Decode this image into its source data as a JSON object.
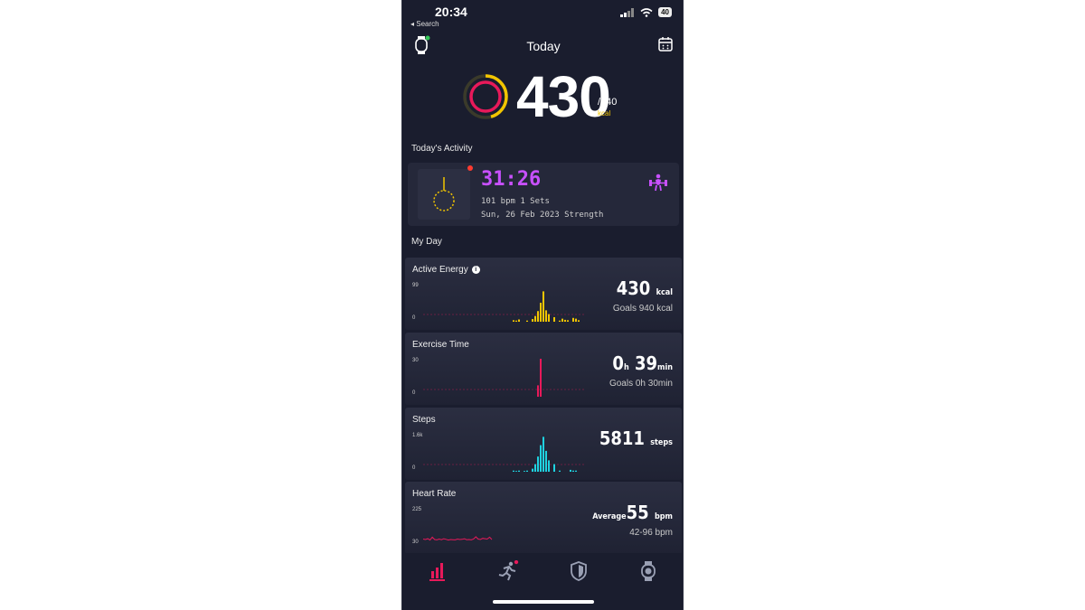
{
  "status": {
    "time": "20:34",
    "back": "◂ Search",
    "battery": "40"
  },
  "header": {
    "title": "Today"
  },
  "summary": {
    "value": "430",
    "goal": "/940",
    "unit": "kcal",
    "progress": 0.457
  },
  "sections": {
    "activity": "Today's Activity",
    "myday": "My Day"
  },
  "activity": {
    "duration": "31:26",
    "meta": "101 bpm   1 Sets",
    "date": "Sun, 26 Feb 2023 Strength"
  },
  "cards": {
    "energy": {
      "title": "Active Energy",
      "ymax": "99",
      "ymin": "0",
      "value": "430",
      "unit": "kcal",
      "goal": "Goals 940 kcal",
      "bars": [
        0,
        0,
        0,
        0,
        0,
        0,
        0,
        0,
        0,
        0,
        0,
        0,
        0,
        0,
        0,
        0,
        0,
        0,
        0,
        0,
        0,
        0,
        0,
        0,
        0,
        0,
        0,
        0,
        0,
        0,
        0,
        0,
        0,
        4,
        3,
        6,
        0,
        0,
        3,
        0,
        7,
        15,
        28,
        50,
        80,
        30,
        20,
        0,
        12,
        0,
        3,
        8,
        5,
        4,
        0,
        10,
        8,
        4,
        0,
        0
      ]
    },
    "exercise": {
      "title": "Exercise Time",
      "ymax": "30",
      "ymin": "0",
      "value_h": "0",
      "value_m": "39",
      "goal": "Goals 0h 30min",
      "bars": [
        0,
        0,
        0,
        0,
        0,
        0,
        0,
        0,
        0,
        0,
        0,
        0,
        0,
        0,
        0,
        0,
        0,
        0,
        0,
        0,
        0,
        0,
        0,
        0,
        0,
        0,
        0,
        0,
        0,
        0,
        0,
        0,
        0,
        0,
        0,
        0,
        0,
        0,
        0,
        0,
        0,
        0,
        30,
        100,
        0,
        0,
        0,
        0,
        0,
        0,
        0,
        0,
        0,
        0,
        0,
        0,
        0,
        0,
        0,
        0
      ]
    },
    "steps": {
      "title": "Steps",
      "ymax": "1.6k",
      "ymin": "0",
      "value": "5811",
      "unit": "steps",
      "bars": [
        0,
        0,
        0,
        0,
        0,
        0,
        0,
        0,
        0,
        0,
        0,
        0,
        0,
        0,
        0,
        0,
        0,
        0,
        0,
        0,
        0,
        0,
        0,
        0,
        0,
        0,
        0,
        0,
        0,
        0,
        0,
        0,
        0,
        3,
        2,
        3,
        0,
        2,
        3,
        0,
        8,
        20,
        40,
        70,
        92,
        55,
        30,
        0,
        20,
        0,
        3,
        0,
        0,
        0,
        5,
        3,
        3,
        0,
        0,
        0
      ]
    },
    "heart": {
      "title": "Heart Rate",
      "ymax": "225",
      "ymin": "30",
      "avg_label": "Average",
      "avg_value": "55",
      "unit": "bpm",
      "range": "42-96 bpm",
      "series": [
        60,
        58,
        62,
        55,
        70,
        58,
        56,
        60,
        57,
        62,
        59,
        55,
        58,
        57,
        56,
        60,
        58,
        59,
        62,
        57,
        58,
        56,
        60,
        72,
        60,
        58,
        64,
        62,
        60,
        70,
        58
      ]
    }
  },
  "colors": {
    "energy": "#f2c500",
    "exercise": "#e8195a",
    "steps": "#1fd2e0",
    "heart": "#e8195a",
    "accent": "#e8195a"
  },
  "tabs": [
    {
      "icon": "bar-chart-icon"
    },
    {
      "icon": "running-icon"
    },
    {
      "icon": "shield-icon"
    },
    {
      "icon": "watch-icon"
    }
  ]
}
